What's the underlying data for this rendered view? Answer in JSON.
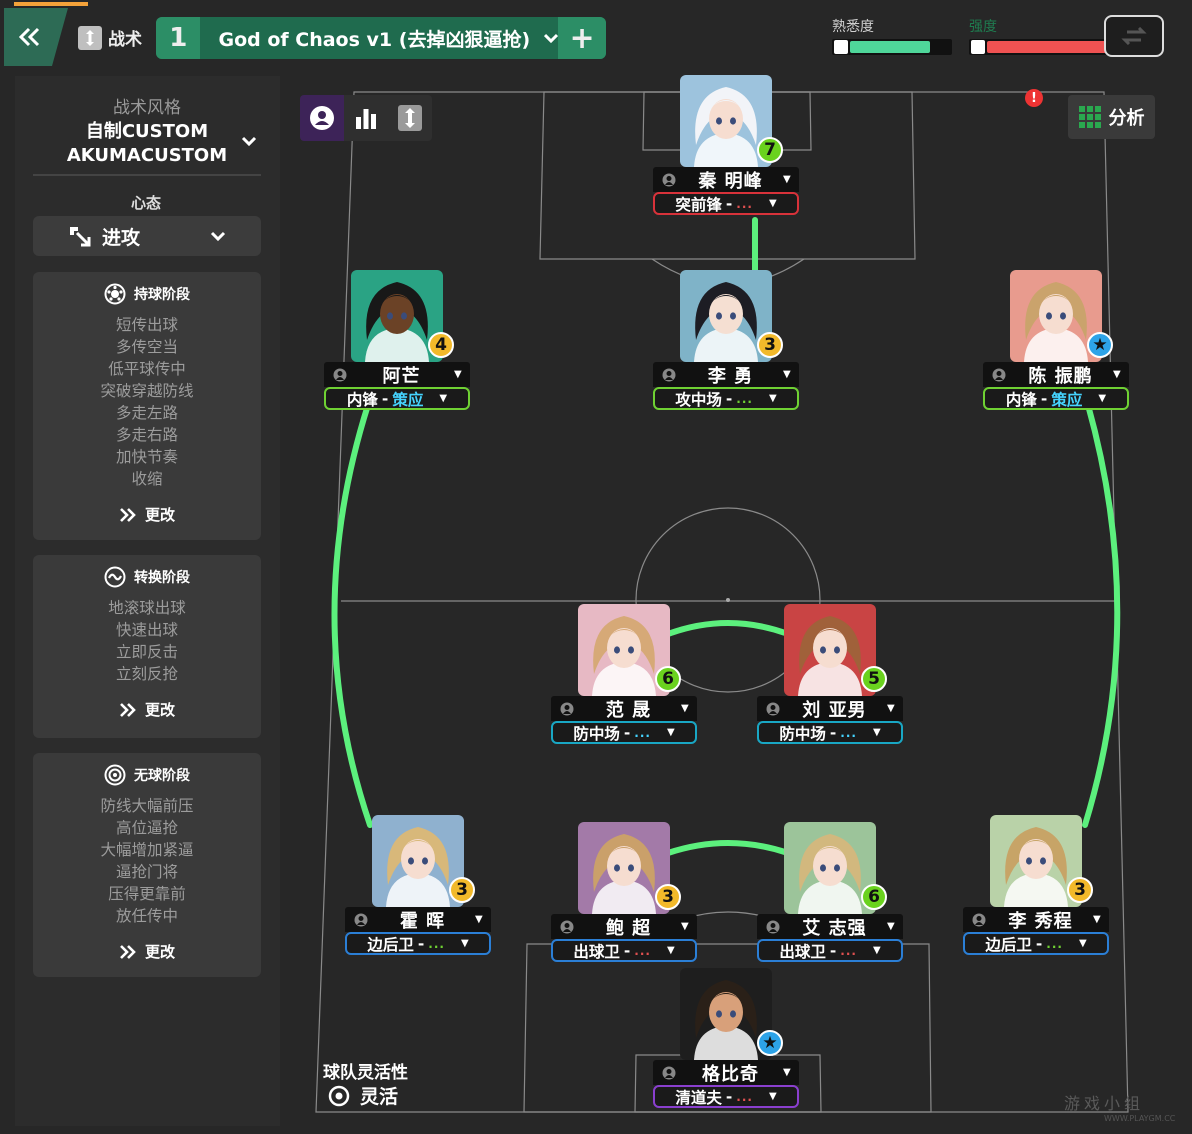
{
  "topbar": {
    "tactics_label": "战术",
    "slot_number": "1",
    "tactic_name": "God of Chaos v1 (去掉凶狠逼抢)",
    "plus": "+",
    "familiarity_label": "熟悉度",
    "familiarity_level": 0.8,
    "intensity_label": "强度",
    "intensity_level": 1.0,
    "familiarity_color": "#4fd69a",
    "intensity_color": "#ef5252"
  },
  "style": {
    "label": "战术风格",
    "name_line1": "自制CUSTOM",
    "name_line2": "AKUMACUSTOM"
  },
  "mentality": {
    "label": "心态",
    "value": "进攻"
  },
  "phases": [
    {
      "title": "持球阶段",
      "icon": "ball-icon",
      "items": [
        "短传出球",
        "多传空当",
        "低平球传中",
        "突破穿越防线",
        "多走左路",
        "多走右路",
        "加快节奏",
        "收缩"
      ],
      "change": "更改"
    },
    {
      "title": "转换阶段",
      "icon": "transition-icon",
      "items": [
        "地滚球出球",
        "快速出球",
        "立即反击",
        "立刻反抢"
      ],
      "change": "更改"
    },
    {
      "title": "无球阶段",
      "icon": "defend-icon",
      "items": [
        "防线大幅前压",
        "高位逼抢",
        "大幅增加紧逼",
        "逼抢门将",
        "压得更靠前",
        "放任传中"
      ],
      "change": "更改"
    }
  ],
  "analysis_label": "分析",
  "flexibility": {
    "label": "球队灵活性",
    "value": "灵活"
  },
  "watermark": {
    "text": "游戏小组",
    "url": "WWW.PLAYGM.CC"
  },
  "players": [
    {
      "name": "秦 明峰",
      "role": "突前锋",
      "duty": "...",
      "rating": "7",
      "rating_color": "#6ad21e",
      "role_color": "#d8323a",
      "duty_color": "#e05050",
      "hair": "#f2f4f8",
      "skin": "#f6ddd0",
      "bg": "#9dc3dd"
    },
    {
      "name": "阿芒",
      "role": "内锋",
      "duty": "策应",
      "rating": "4",
      "rating_color": "#f2b92a",
      "role_color": "#6fd133",
      "duty_color": "#45d4ff",
      "hair": "#181818",
      "skin": "#6b4226",
      "bg": "#2aa384"
    },
    {
      "name": "李 勇",
      "role": "攻中场",
      "duty": "...",
      "rating": "3",
      "rating_color": "#f2b92a",
      "role_color": "#6fd133",
      "duty_color": "#6fd133",
      "hair": "#1d1d24",
      "skin": "#f5dfd2",
      "bg": "#7fb3c8"
    },
    {
      "name": "陈 振鹏",
      "role": "内锋",
      "duty": "策应",
      "rating": "★",
      "rating_color": "#2da3e8",
      "role_color": "#6fd133",
      "duty_color": "#45d4ff",
      "hair": "#caa36c",
      "skin": "#f6ddd0",
      "bg": "#e89b8e"
    },
    {
      "name": "范 晟",
      "role": "防中场",
      "duty": "...",
      "rating": "6",
      "rating_color": "#6ad21e",
      "role_color": "#19a7c4",
      "duty_color": "#45d4ff",
      "hair": "#d6a977",
      "skin": "#f6ddd0",
      "bg": "#e7b9c4"
    },
    {
      "name": "刘 亚男",
      "role": "防中场",
      "duty": "...",
      "rating": "5",
      "rating_color": "#6ad21e",
      "role_color": "#19a7c4",
      "duty_color": "#45d4ff",
      "hair": "#a0613a",
      "skin": "#f6ddd0",
      "bg": "#c94444"
    },
    {
      "name": "霍 晖",
      "role": "边后卫",
      "duty": "...",
      "rating": "3",
      "rating_color": "#f2b92a",
      "role_color": "#2b7fd6",
      "duty_color": "#6fd133",
      "hair": "#d8b87a",
      "skin": "#f6ddd0",
      "bg": "#8fb1cf"
    },
    {
      "name": "鲍 超",
      "role": "出球卫",
      "duty": "...",
      "rating": "3",
      "rating_color": "#f2b92a",
      "role_color": "#2b7fd6",
      "duty_color": "#e05050",
      "hair": "#caa06a",
      "skin": "#f6ddd0",
      "bg": "#a37aa8"
    },
    {
      "name": "艾 志强",
      "role": "出球卫",
      "duty": "...",
      "rating": "6",
      "rating_color": "#6ad21e",
      "role_color": "#2b7fd6",
      "duty_color": "#e05050",
      "hair": "#d2b87e",
      "skin": "#f6ddd0",
      "bg": "#9cc49a"
    },
    {
      "name": "李 秀程",
      "role": "边后卫",
      "duty": "...",
      "rating": "3",
      "rating_color": "#f2b92a",
      "role_color": "#2b7fd6",
      "duty_color": "#6fd133",
      "hair": "#c7a467",
      "skin": "#f6ddd0",
      "bg": "#b9d2a8"
    },
    {
      "name": "格比奇",
      "role": "清道夫",
      "duty": "...",
      "rating": "★",
      "rating_color": "#2da3e8",
      "role_color": "#8a3fcf",
      "duty_color": "#e05050",
      "hair": "#2a2018",
      "skin": "#d8a07a",
      "bg": "#1e1e1e"
    }
  ]
}
